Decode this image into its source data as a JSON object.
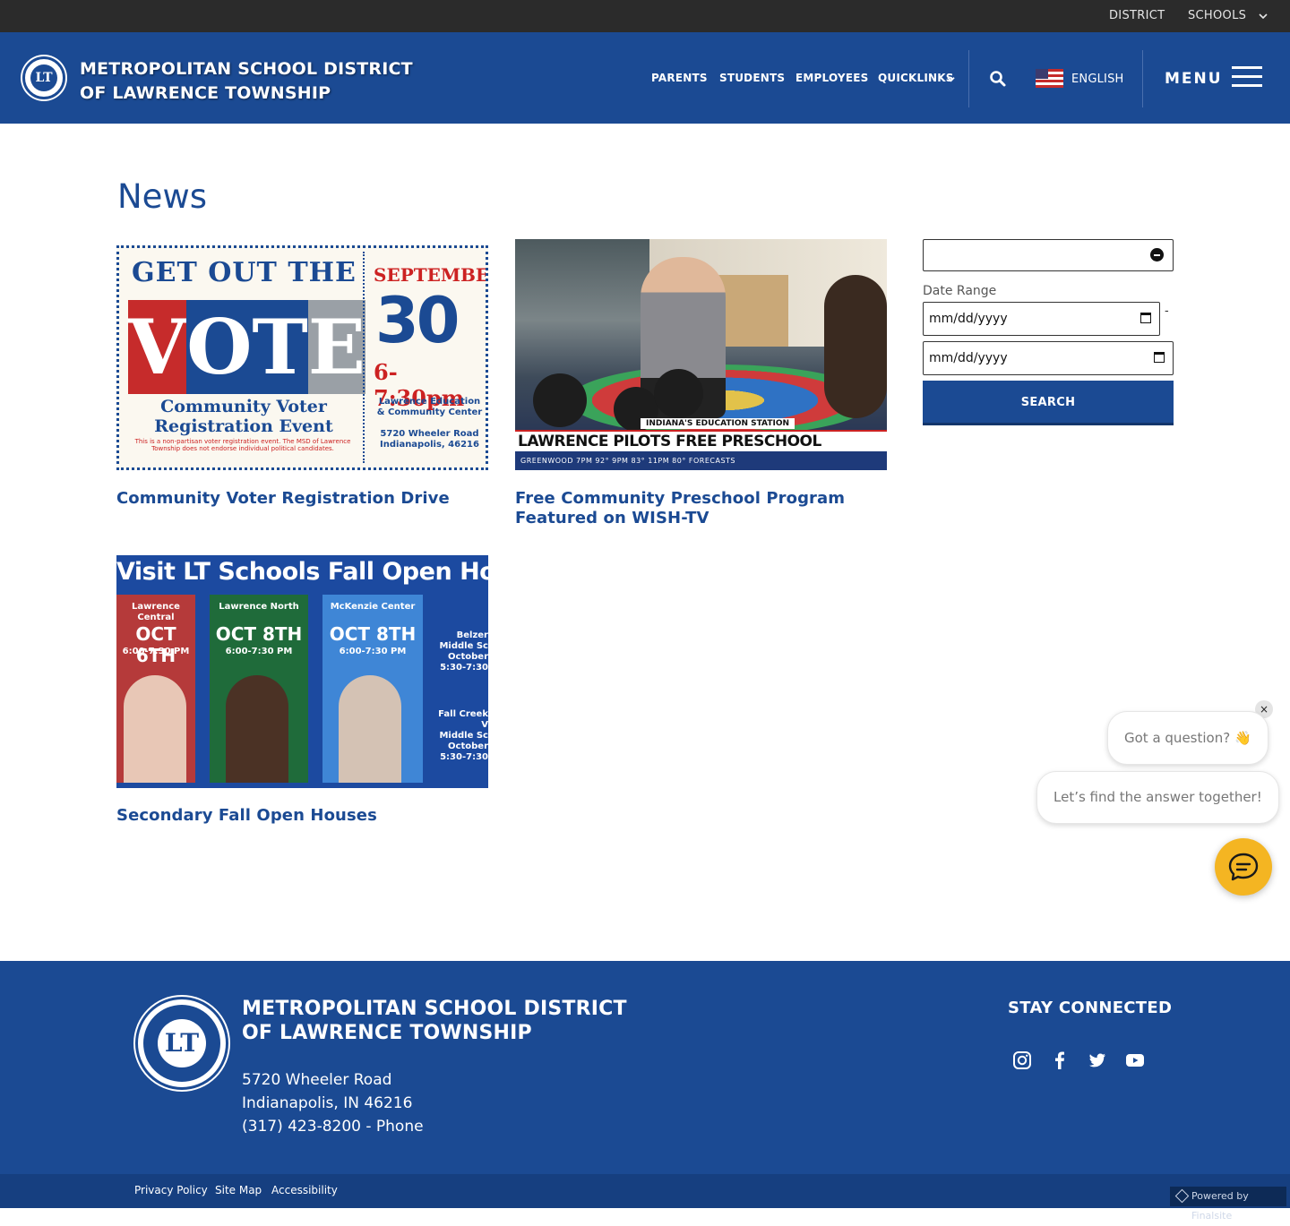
{
  "topbar": {
    "district": "DISTRICT",
    "schools": "SCHOOLS"
  },
  "header": {
    "logo_initials": "LT",
    "title_line1": "METROPOLITAN SCHOOL DISTRICT",
    "title_line2": "OF LAWRENCE TOWNSHIP",
    "nav": [
      "PARENTS",
      "STUDENTS",
      "EMPLOYEES",
      "QUICKLINKS"
    ],
    "language": "ENGLISH",
    "menu": "MENU"
  },
  "main": {
    "title": "News",
    "cards": [
      {
        "title": "Community Voter Registration Drive",
        "image_text": {
          "headline": "GET OUT THE",
          "vote_letters": [
            "V",
            "O",
            "T",
            "E"
          ],
          "subtitle": "Community Voter Registration Event",
          "disclaimer": "This is a non-partisan voter registration event. The MSD of Lawrence Township does not endorse individual political candidates.",
          "month": "SEPTEMBER",
          "day": "30",
          "time": "6-7:30pm",
          "location": "Lawrence Education & Community Center",
          "address": "5720 Wheeler Road Indianapolis, 46216"
        }
      },
      {
        "title": "Free Community Preschool Program Featured on WISH-TV",
        "image_text": {
          "tag": "INDIANA'S EDUCATION STATION",
          "chyron": "LAWRENCE PILOTS FREE PRESCHOOL",
          "ticker": "GREENWOOD  7PM 92°  9PM 83°  11PM 80°  FORECASTS"
        }
      },
      {
        "title": "Secondary Fall Open Houses",
        "image_text": {
          "banner": "Visit LT Schools Fall Open Houses!",
          "panels": [
            {
              "name": "Lawrence Central",
              "date": "OCT 6TH",
              "time": "6:00-7:30 PM"
            },
            {
              "name": "Lawrence North",
              "date": "OCT 8TH",
              "time": "6:00-7:30 PM"
            },
            {
              "name": "McKenzie Center",
              "date": "OCT 8TH",
              "time": "6:00-7:30 PM"
            }
          ],
          "side": [
            "Belzer Middle Sc",
            "October",
            "5:30-7:30",
            "Fall Creek V",
            "Middle Sc",
            "October",
            "5:30-7:30"
          ]
        }
      }
    ]
  },
  "sidebar": {
    "keyword_value": "",
    "date_range_label": "Date Range",
    "date_from_placeholder": "mm/dd/yyyy",
    "date_to_placeholder": "mm/dd/yyyy",
    "dash": "-",
    "search_label": "SEARCH"
  },
  "chat": {
    "close": "×",
    "bubble1": "Got a question? 👋",
    "bubble2": "Let’s find the answer together!"
  },
  "footer": {
    "title_line1": "METROPOLITAN SCHOOL DISTRICT",
    "title_line2": "OF LAWRENCE TOWNSHIP",
    "logo_initials": "LT",
    "address1": "5720 Wheeler Road",
    "address2": "Indianapolis, IN  46216",
    "phone": "(317) 423-8200 - Phone",
    "stay_connected": "STAY CONNECTED",
    "social": [
      "instagram-icon",
      "facebook-icon",
      "twitter-icon",
      "youtube-icon"
    ],
    "links": [
      "Privacy Policy",
      "Site Map",
      "Accessibility"
    ],
    "powered": "Powered by Finalsite"
  },
  "colors": {
    "brand_blue": "#1b4a93",
    "topbar": "#2b2b2b",
    "chat_accent": "#f4b522"
  }
}
